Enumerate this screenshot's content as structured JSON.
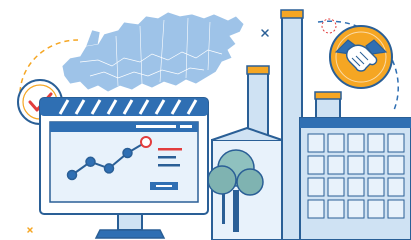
{
  "illustration": {
    "theme": "industry-and-partnership",
    "elements": [
      "russia-map",
      "checkmark-badge",
      "monitor-with-line-chart",
      "factory",
      "tree",
      "handshake-badge",
      "sparkle-marks"
    ]
  },
  "monitor_chart": {
    "type": "line",
    "values": [
      0.25,
      0.55,
      0.4,
      0.75,
      1.0
    ],
    "highlight_last": true
  },
  "colors": {
    "outline": "#2a5f96",
    "blue": "#2f6fb3",
    "light_blue": "#cfe2f3",
    "map_blue": "#8fb8e2",
    "orange": "#f5a623",
    "red": "#e23d3d",
    "tree_green": "#7fb3b1",
    "background": "#ffffff"
  }
}
